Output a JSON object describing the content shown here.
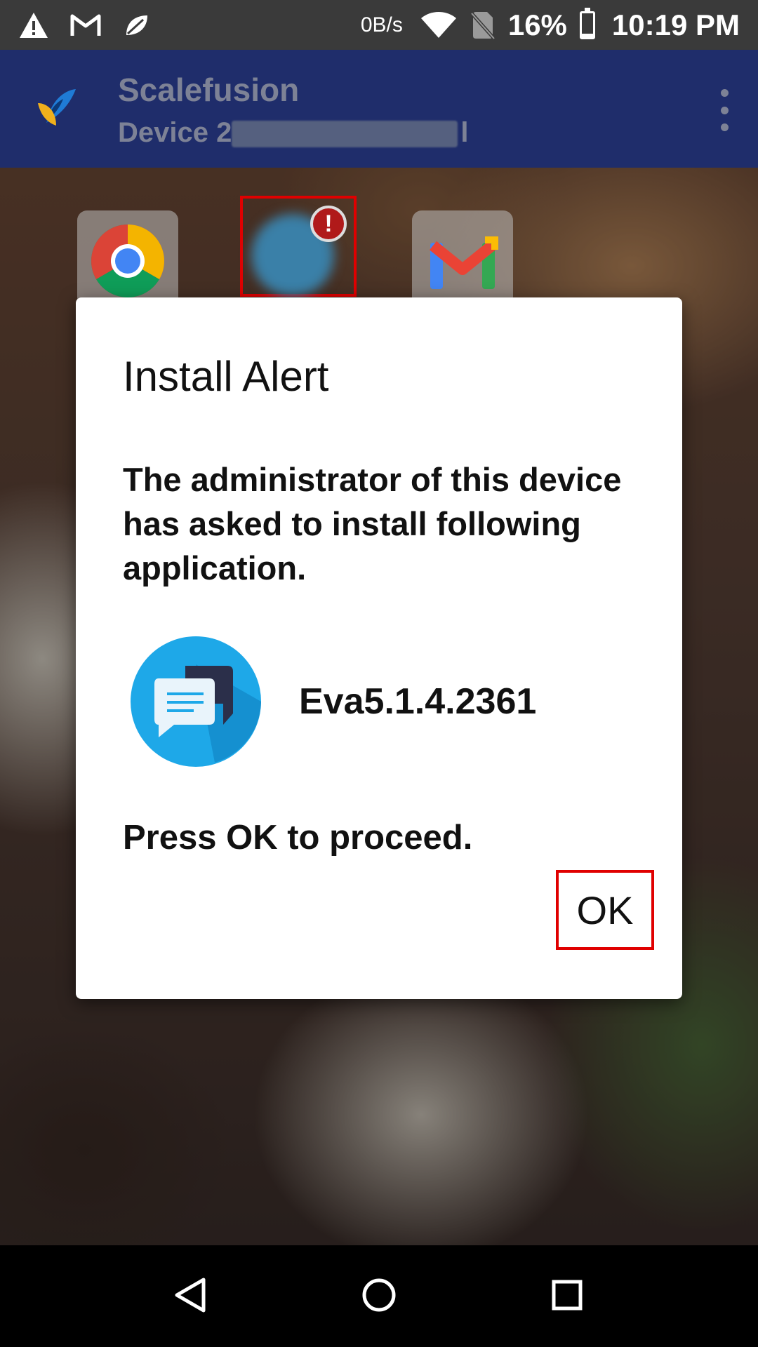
{
  "status_bar": {
    "network_speed": "0B/s",
    "battery_percent": "16%",
    "battery_level": 0.16,
    "time": "10:19 PM",
    "left_icons": [
      "warning-icon",
      "gmail-notification-icon",
      "leaf-notification-icon"
    ],
    "right_icons": [
      "wifi-icon",
      "no-sim-icon",
      "battery-icon"
    ]
  },
  "app_bar": {
    "title": "Scalefusion",
    "subtitle_prefix": "Device 2",
    "subtitle_suffix": "l",
    "title_color": "#7d8296",
    "background": "#1f2d6b"
  },
  "home_screen": {
    "apps": [
      "chrome-icon",
      "eva-app-icon",
      "gmail-icon"
    ],
    "badge_text": "!"
  },
  "dialog": {
    "title": "Install Alert",
    "message": "The administrator of this device has asked to install following application.",
    "app_name": "Eva5.1.4.2361",
    "proceed_text": "Press OK to proceed.",
    "ok_label": "OK",
    "highlight_color": "#e00000"
  },
  "nav_bar": {
    "buttons": [
      "back-icon",
      "home-icon",
      "recents-icon"
    ]
  }
}
